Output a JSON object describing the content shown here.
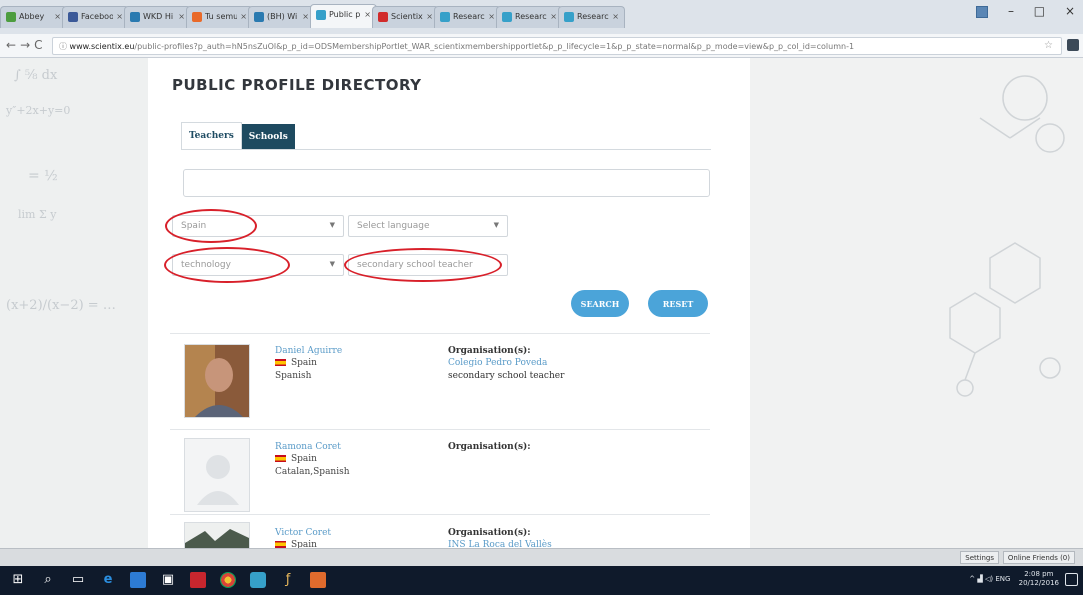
{
  "browser": {
    "tabs": [
      {
        "label": "Abbey",
        "color": "#4d9d3f"
      },
      {
        "label": "Facebook",
        "color": "#3b5998"
      },
      {
        "label": "WKD Hi",
        "color": "#2a7ab0"
      },
      {
        "label": "Tu semu",
        "color": "#e96a2a"
      },
      {
        "label": "(BH) Wi",
        "color": "#2a7ab0"
      },
      {
        "label": "Public p",
        "color": "#36a0c9"
      },
      {
        "label": "Scientix",
        "color": "#d12b2b"
      },
      {
        "label": "Research",
        "color": "#36a0c9"
      },
      {
        "label": "Research",
        "color": "#36a0c9"
      },
      {
        "label": "Research",
        "color": "#36a0c9"
      }
    ],
    "active_tab": 5,
    "window_controls": {
      "minimize": "–",
      "close": "×"
    },
    "url_domain": "www.scientix.eu",
    "url_path": "/public-profiles?p_auth=hN5nsZuOl&p_p_id=ODSMembershipPortlet_WAR_scientixmembershipportlet&p_p_lifecycle=1&p_p_state=normal&p_p_mode=view&p_p_col_id=column-1"
  },
  "page": {
    "title": "PUBLIC PROFILE DIRECTORY",
    "tabs": [
      "Teachers",
      "Schools"
    ],
    "search_value": "",
    "filters": {
      "country": "Spain",
      "language_placeholder": "Select language",
      "subject": "technology",
      "position": "secondary school teacher"
    },
    "search_label": "SEARCH",
    "reset_label": "RESET",
    "org_label": "Organisation(s):"
  },
  "profiles": [
    {
      "name": "Daniel Aguirre",
      "country": "Spain",
      "languages": "Spanish",
      "organisation": "Colegio Pedro Poveda",
      "role": "secondary school teacher"
    },
    {
      "name": "Ramona Coret",
      "country": "Spain",
      "languages": "Catalan,Spanish",
      "organisation": "",
      "role": ""
    },
    {
      "name": "Victor Coret",
      "country": "Spain",
      "languages": "",
      "organisation": "INS La Roca del Vallès",
      "role": ""
    }
  ],
  "statusbar": {
    "settings": "Settings",
    "friends": "Online Friends (0)"
  },
  "taskbar": {
    "lang": "ENG",
    "time": "2:08 pm",
    "date": "20/12/2016"
  },
  "colors": {
    "accent": "#4ba4d9",
    "tab_dark": "#1e4a60",
    "annotation": "#d8202a"
  }
}
